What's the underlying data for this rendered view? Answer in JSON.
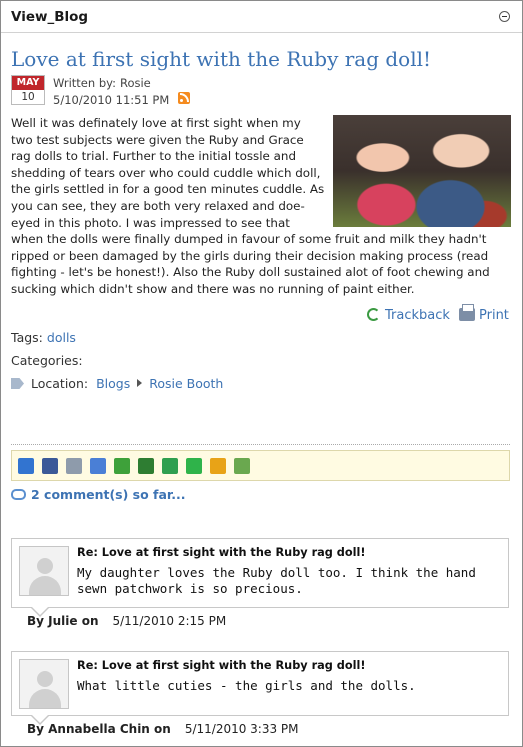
{
  "module": {
    "title": "View_Blog"
  },
  "post": {
    "title": "Love at first sight with the Ruby rag doll!",
    "date_month": "MAY",
    "date_day": "10",
    "written_by_label": "Written by:",
    "author": "Rosie",
    "datetime": "5/10/2010 11:51 PM",
    "body": "Well it was definately love at first sight when my two test subjects were given the Ruby and Grace rag dolls to trial. Further to the initial tossle and shedding of tears over who could cuddle which doll, the girls settled in for a good ten minutes cuddle. As you can see, they are both very relaxed and doe-eyed in this photo. I was impressed to see that when the dolls were finally dumped in favour of some fruit and milk they hadn't ripped or been damaged by the girls during their decision making process (read fighting - let's be honest!). Also the Ruby doll sustained alot of foot chewing and sucking which didn't show and there was no running of paint either."
  },
  "actions": {
    "trackback": "Trackback",
    "print": "Print"
  },
  "meta": {
    "tags_label": "Tags:",
    "tag": "dolls",
    "categories_label": "Categories:",
    "location_label": "Location:",
    "location_path": [
      "Blogs",
      "Rosie Booth"
    ]
  },
  "share_icons": [
    {
      "name": "delicious-icon",
      "color": "#3274d0"
    },
    {
      "name": "facebook-icon",
      "color": "#3b5998"
    },
    {
      "name": "myspace-icon",
      "color": "#8e9bab"
    },
    {
      "name": "google-icon",
      "color": "#4a7fd6"
    },
    {
      "name": "windows-live-icon",
      "color": "#3ea13a"
    },
    {
      "name": "blinklist-icon",
      "color": "#2e7d32"
    },
    {
      "name": "stumbleupon-icon",
      "color": "#2f9f4f"
    },
    {
      "name": "technorati-icon",
      "color": "#2fb34a"
    },
    {
      "name": "digg-icon",
      "color": "#e8a317"
    },
    {
      "name": "msn-icon",
      "color": "#6aa84f"
    }
  ],
  "comments_summary": "2 comment(s) so far...",
  "comments": [
    {
      "title": "Re: Love at first sight with the Ruby rag doll!",
      "text": "My daughter loves the Ruby doll too. I think the hand sewn patchwork is so precious.",
      "by": "By Julie on",
      "datetime": "5/11/2010 2:15 PM"
    },
    {
      "title": "Re: Love at first sight with the Ruby rag doll!",
      "text": "What little cuties - the girls and the dolls.",
      "by": "By Annabella Chin on",
      "datetime": "5/11/2010 3:33 PM"
    }
  ]
}
